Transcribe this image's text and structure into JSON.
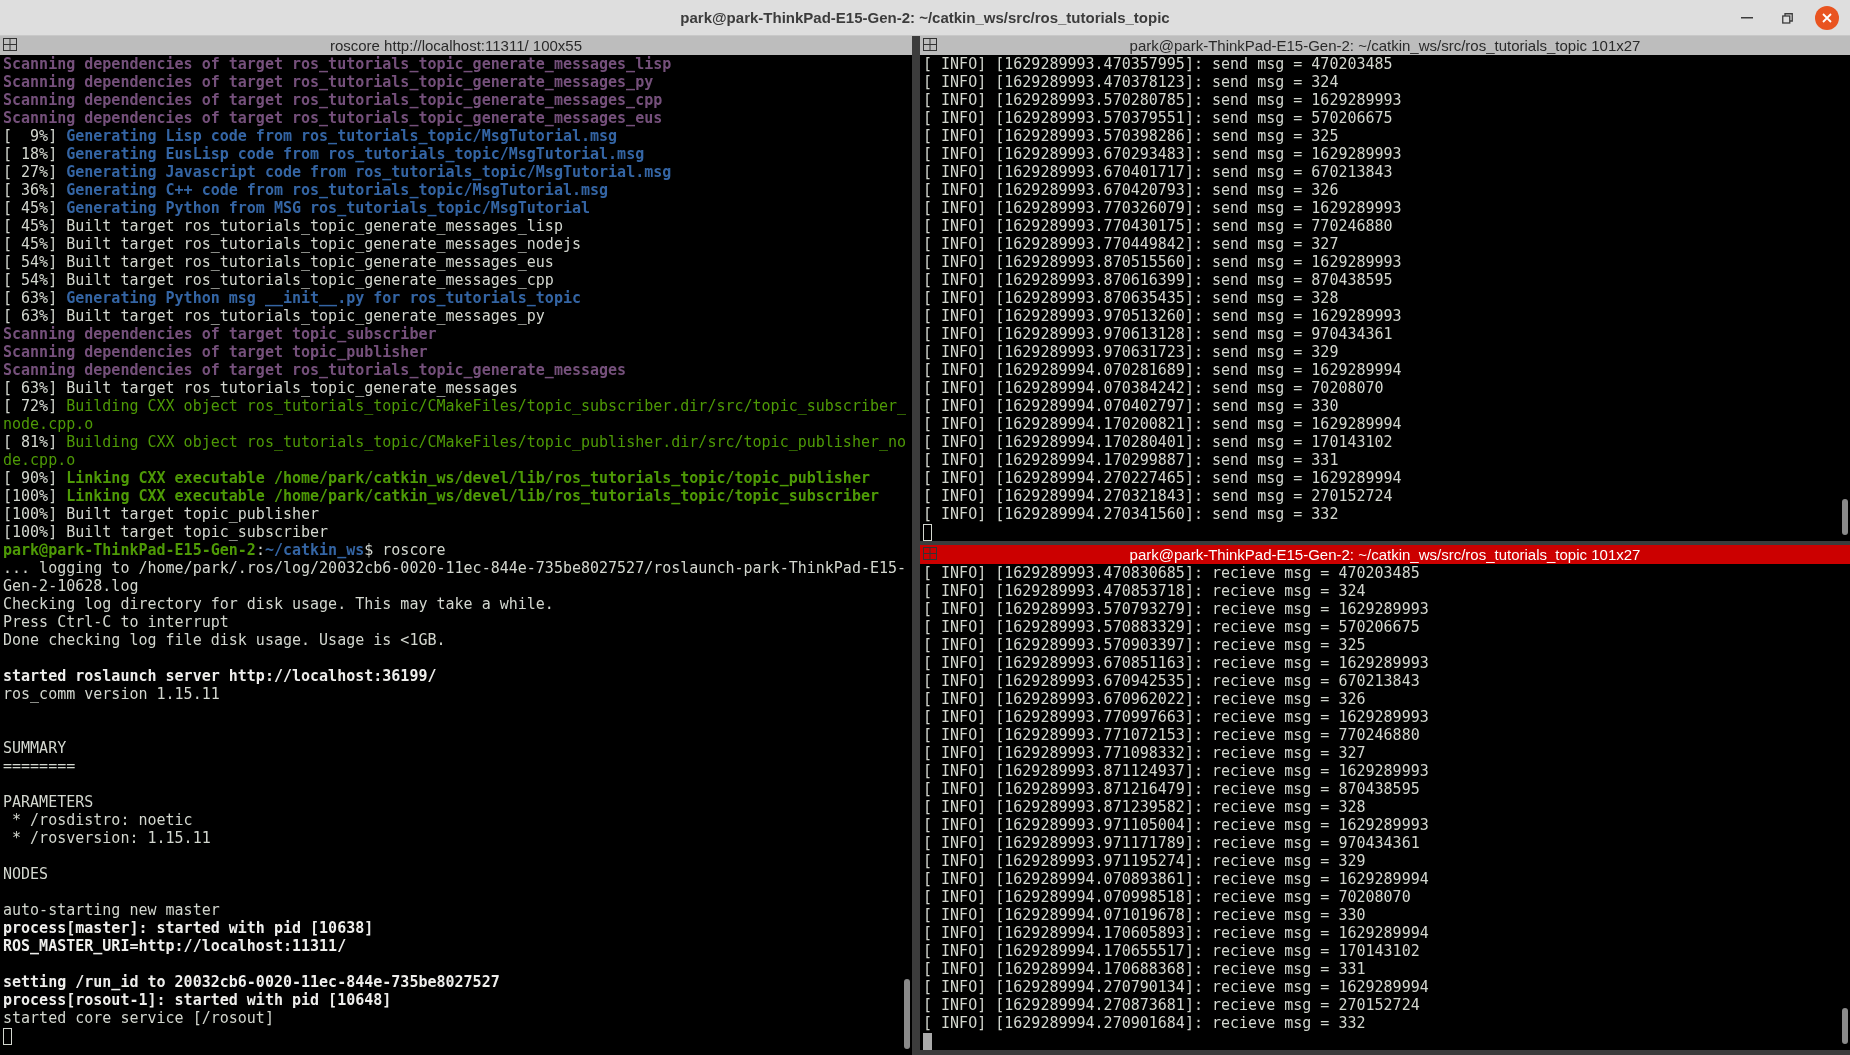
{
  "window": {
    "title": "park@park-ThinkPad-E15-Gen-2: ~/catkin_ws/src/ros_tutorials_topic"
  },
  "left_pane": {
    "title": "roscore http://localhost:11311/ 100x55",
    "active": false,
    "lines": [
      {
        "kind": "scan",
        "text": "Scanning dependencies of target ros_tutorials_topic_generate_messages_lisp"
      },
      {
        "kind": "scan",
        "text": "Scanning dependencies of target ros_tutorials_topic_generate_messages_py"
      },
      {
        "kind": "scan",
        "text": "Scanning dependencies of target ros_tutorials_topic_generate_messages_cpp"
      },
      {
        "kind": "scan",
        "text": "Scanning dependencies of target ros_tutorials_topic_generate_messages_eus"
      },
      {
        "kind": "generate",
        "progress": "[  9%]",
        "text": "Generating Lisp code from ros_tutorials_topic/MsgTutorial.msg"
      },
      {
        "kind": "generate",
        "progress": "[ 18%]",
        "text": "Generating EusLisp code from ros_tutorials_topic/MsgTutorial.msg"
      },
      {
        "kind": "generate",
        "progress": "[ 27%]",
        "text": "Generating Javascript code from ros_tutorials_topic/MsgTutorial.msg"
      },
      {
        "kind": "generate",
        "progress": "[ 36%]",
        "text": "Generating C++ code from ros_tutorials_topic/MsgTutorial.msg"
      },
      {
        "kind": "generate",
        "progress": "[ 45%]",
        "text": "Generating Python from MSG ros_tutorials_topic/MsgTutorial"
      },
      {
        "kind": "plain",
        "text": "[ 45%] Built target ros_tutorials_topic_generate_messages_lisp"
      },
      {
        "kind": "plain",
        "text": "[ 45%] Built target ros_tutorials_topic_generate_messages_nodejs"
      },
      {
        "kind": "plain",
        "text": "[ 54%] Built target ros_tutorials_topic_generate_messages_eus"
      },
      {
        "kind": "plain",
        "text": "[ 54%] Built target ros_tutorials_topic_generate_messages_cpp"
      },
      {
        "kind": "generate",
        "progress": "[ 63%]",
        "text": "Generating Python msg __init__.py for ros_tutorials_topic"
      },
      {
        "kind": "plain",
        "text": "[ 63%] Built target ros_tutorials_topic_generate_messages_py"
      },
      {
        "kind": "scan",
        "text": "Scanning dependencies of target topic_subscriber"
      },
      {
        "kind": "scan",
        "text": "Scanning dependencies of target topic_publisher"
      },
      {
        "kind": "scan",
        "text": "Scanning dependencies of target ros_tutorials_topic_generate_messages"
      },
      {
        "kind": "plain",
        "text": "[ 63%] Built target ros_tutorials_topic_generate_messages"
      },
      {
        "kind": "building",
        "progress": "[ 72%]",
        "text": "Building CXX object ros_tutorials_topic/CMakeFiles/topic_subscriber.dir/src/topic_subscriber_"
      },
      {
        "kind": "building",
        "text": "node.cpp.o"
      },
      {
        "kind": "building",
        "progress": "[ 81%]",
        "text": "Building CXX object ros_tutorials_topic/CMakeFiles/topic_publisher.dir/src/topic_publisher_no"
      },
      {
        "kind": "building",
        "text": "de.cpp.o"
      },
      {
        "kind": "linking",
        "progress": "[ 90%]",
        "text": "Linking CXX executable /home/park/catkin_ws/devel/lib/ros_tutorials_topic/topic_publisher"
      },
      {
        "kind": "linking",
        "progress": "[100%]",
        "text": "Linking CXX executable /home/park/catkin_ws/devel/lib/ros_tutorials_topic/topic_subscriber"
      },
      {
        "kind": "plain",
        "text": "[100%] Built target topic_publisher"
      },
      {
        "kind": "plain",
        "text": "[100%] Built target topic_subscriber"
      },
      {
        "kind": "prompt",
        "user_host": "park@park-ThinkPad-E15-Gen-2",
        "separator": ":",
        "path": "~/catkin_ws",
        "command": "$ roscore"
      },
      {
        "kind": "plain",
        "text": "... logging to /home/park/.ros/log/20032cb6-0020-11ec-844e-735be8027527/roslaunch-park-ThinkPad-E15-"
      },
      {
        "kind": "plain",
        "text": "Gen-2-10628.log"
      },
      {
        "kind": "plain",
        "text": "Checking log directory for disk usage. This may take a while."
      },
      {
        "kind": "plain",
        "text": "Press Ctrl-C to interrupt"
      },
      {
        "kind": "plain",
        "text": "Done checking log file disk usage. Usage is <1GB."
      },
      {
        "kind": "blank"
      },
      {
        "kind": "bold",
        "text": "started roslaunch server http://localhost:36199/"
      },
      {
        "kind": "plain",
        "text": "ros_comm version 1.15.11"
      },
      {
        "kind": "blank"
      },
      {
        "kind": "blank"
      },
      {
        "kind": "plain",
        "text": "SUMMARY"
      },
      {
        "kind": "plain",
        "text": "========"
      },
      {
        "kind": "blank"
      },
      {
        "kind": "plain",
        "text": "PARAMETERS"
      },
      {
        "kind": "plain",
        "text": " * /rosdistro: noetic"
      },
      {
        "kind": "plain",
        "text": " * /rosversion: 1.15.11"
      },
      {
        "kind": "blank"
      },
      {
        "kind": "plain",
        "text": "NODES"
      },
      {
        "kind": "blank"
      },
      {
        "kind": "plain",
        "text": "auto-starting new master"
      },
      {
        "kind": "bold",
        "text": "process[master]: started with pid [10638]"
      },
      {
        "kind": "bold",
        "text": "ROS_MASTER_URI=http://localhost:11311/"
      },
      {
        "kind": "blank"
      },
      {
        "kind": "bold",
        "text": "setting /run_id to 20032cb6-0020-11ec-844e-735be8027527"
      },
      {
        "kind": "bold",
        "text": "process[rosout-1]: started with pid [10648]"
      },
      {
        "kind": "plain",
        "text": "started core service [/rosout]"
      },
      {
        "kind": "cursor"
      }
    ]
  },
  "right_panes": [
    {
      "title": "park@park-ThinkPad-E15-Gen-2: ~/catkin_ws/src/ros_tutorials_topic 101x27",
      "active": false,
      "lines": [
        {
          "kind": "plain",
          "text": "[ INFO] [1629289993.470357995]: send msg = 470203485"
        },
        {
          "kind": "plain",
          "text": "[ INFO] [1629289993.470378123]: send msg = 324"
        },
        {
          "kind": "plain",
          "text": "[ INFO] [1629289993.570280785]: send msg = 1629289993"
        },
        {
          "kind": "plain",
          "text": "[ INFO] [1629289993.570379551]: send msg = 570206675"
        },
        {
          "kind": "plain",
          "text": "[ INFO] [1629289993.570398286]: send msg = 325"
        },
        {
          "kind": "plain",
          "text": "[ INFO] [1629289993.670293483]: send msg = 1629289993"
        },
        {
          "kind": "plain",
          "text": "[ INFO] [1629289993.670401717]: send msg = 670213843"
        },
        {
          "kind": "plain",
          "text": "[ INFO] [1629289993.670420793]: send msg = 326"
        },
        {
          "kind": "plain",
          "text": "[ INFO] [1629289993.770326079]: send msg = 1629289993"
        },
        {
          "kind": "plain",
          "text": "[ INFO] [1629289993.770430175]: send msg = 770246880"
        },
        {
          "kind": "plain",
          "text": "[ INFO] [1629289993.770449842]: send msg = 327"
        },
        {
          "kind": "plain",
          "text": "[ INFO] [1629289993.870515560]: send msg = 1629289993"
        },
        {
          "kind": "plain",
          "text": "[ INFO] [1629289993.870616399]: send msg = 870438595"
        },
        {
          "kind": "plain",
          "text": "[ INFO] [1629289993.870635435]: send msg = 328"
        },
        {
          "kind": "plain",
          "text": "[ INFO] [1629289993.970513260]: send msg = 1629289993"
        },
        {
          "kind": "plain",
          "text": "[ INFO] [1629289993.970613128]: send msg = 970434361"
        },
        {
          "kind": "plain",
          "text": "[ INFO] [1629289993.970631723]: send msg = 329"
        },
        {
          "kind": "plain",
          "text": "[ INFO] [1629289994.070281689]: send msg = 1629289994"
        },
        {
          "kind": "plain",
          "text": "[ INFO] [1629289994.070384242]: send msg = 70208070"
        },
        {
          "kind": "plain",
          "text": "[ INFO] [1629289994.070402797]: send msg = 330"
        },
        {
          "kind": "plain",
          "text": "[ INFO] [1629289994.170200821]: send msg = 1629289994"
        },
        {
          "kind": "plain",
          "text": "[ INFO] [1629289994.170280401]: send msg = 170143102"
        },
        {
          "kind": "plain",
          "text": "[ INFO] [1629289994.170299887]: send msg = 331"
        },
        {
          "kind": "plain",
          "text": "[ INFO] [1629289994.270227465]: send msg = 1629289994"
        },
        {
          "kind": "plain",
          "text": "[ INFO] [1629289994.270321843]: send msg = 270152724"
        },
        {
          "kind": "plain",
          "text": "[ INFO] [1629289994.270341560]: send msg = 332"
        },
        {
          "kind": "cursor"
        }
      ]
    },
    {
      "title": "park@park-ThinkPad-E15-Gen-2: ~/catkin_ws/src/ros_tutorials_topic 101x27",
      "active": true,
      "lines": [
        {
          "kind": "plain",
          "text": "[ INFO] [1629289993.470830685]: recieve msg = 470203485"
        },
        {
          "kind": "plain",
          "text": "[ INFO] [1629289993.470853718]: recieve msg = 324"
        },
        {
          "kind": "plain",
          "text": "[ INFO] [1629289993.570793279]: recieve msg = 1629289993"
        },
        {
          "kind": "plain",
          "text": "[ INFO] [1629289993.570883329]: recieve msg = 570206675"
        },
        {
          "kind": "plain",
          "text": "[ INFO] [1629289993.570903397]: recieve msg = 325"
        },
        {
          "kind": "plain",
          "text": "[ INFO] [1629289993.670851163]: recieve msg = 1629289993"
        },
        {
          "kind": "plain",
          "text": "[ INFO] [1629289993.670942535]: recieve msg = 670213843"
        },
        {
          "kind": "plain",
          "text": "[ INFO] [1629289993.670962022]: recieve msg = 326"
        },
        {
          "kind": "plain",
          "text": "[ INFO] [1629289993.770997663]: recieve msg = 1629289993"
        },
        {
          "kind": "plain",
          "text": "[ INFO] [1629289993.771072153]: recieve msg = 770246880"
        },
        {
          "kind": "plain",
          "text": "[ INFO] [1629289993.771098332]: recieve msg = 327"
        },
        {
          "kind": "plain",
          "text": "[ INFO] [1629289993.871124937]: recieve msg = 1629289993"
        },
        {
          "kind": "plain",
          "text": "[ INFO] [1629289993.871216479]: recieve msg = 870438595"
        },
        {
          "kind": "plain",
          "text": "[ INFO] [1629289993.871239582]: recieve msg = 328"
        },
        {
          "kind": "plain",
          "text": "[ INFO] [1629289993.971105004]: recieve msg = 1629289993"
        },
        {
          "kind": "plain",
          "text": "[ INFO] [1629289993.971171789]: recieve msg = 970434361"
        },
        {
          "kind": "plain",
          "text": "[ INFO] [1629289993.971195274]: recieve msg = 329"
        },
        {
          "kind": "plain",
          "text": "[ INFO] [1629289994.070893861]: recieve msg = 1629289994"
        },
        {
          "kind": "plain",
          "text": "[ INFO] [1629289994.070998518]: recieve msg = 70208070"
        },
        {
          "kind": "plain",
          "text": "[ INFO] [1629289994.071019678]: recieve msg = 330"
        },
        {
          "kind": "plain",
          "text": "[ INFO] [1629289994.170605893]: recieve msg = 1629289994"
        },
        {
          "kind": "plain",
          "text": "[ INFO] [1629289994.170655517]: recieve msg = 170143102"
        },
        {
          "kind": "plain",
          "text": "[ INFO] [1629289994.170688368]: recieve msg = 331"
        },
        {
          "kind": "plain",
          "text": "[ INFO] [1629289994.270790134]: recieve msg = 1629289994"
        },
        {
          "kind": "plain",
          "text": "[ INFO] [1629289994.270873681]: recieve msg = 270152724"
        },
        {
          "kind": "plain",
          "text": "[ INFO] [1629289994.270901684]: recieve msg = 332"
        },
        {
          "kind": "cursor"
        }
      ]
    }
  ]
}
